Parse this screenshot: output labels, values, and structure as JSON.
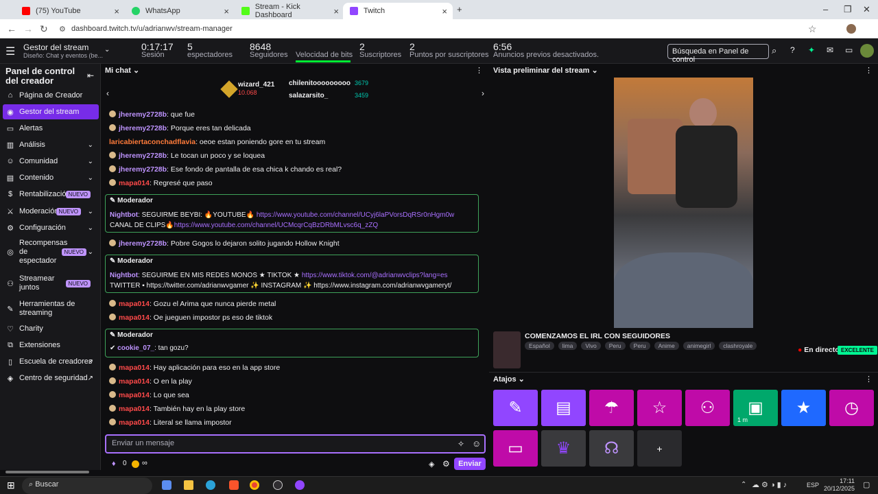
{
  "browser": {
    "tabs": [
      {
        "label": "(75) YouTube",
        "color": "#ff0000"
      },
      {
        "label": "WhatsApp",
        "color": "#25d366"
      },
      {
        "label": "Stream - Kick Dashboard",
        "color": "#53fc18"
      },
      {
        "label": "Twitch",
        "color": "#9146ff"
      }
    ],
    "url": "dashboard.twitch.tv/u/adrianwv/stream-manager"
  },
  "header": {
    "title": "Gestor del stream",
    "subtitle": "Diseño: Chat y eventos (be...",
    "search_placeholder": "Búsqueda en Panel de control"
  },
  "stats": [
    {
      "value": "0:17:17",
      "label": "Sesión"
    },
    {
      "value": "5",
      "label": "espectadores"
    },
    {
      "value": "8648",
      "label": "Seguidores"
    },
    {
      "value": "",
      "label": "Velocidad de bits"
    },
    {
      "value": "2",
      "label": "Suscriptores"
    },
    {
      "value": "2",
      "label": "Puntos por suscriptores"
    },
    {
      "value": "6:56",
      "label": "Anuncios previos desactivados."
    }
  ],
  "sidebar": {
    "title": "Panel de control del creador",
    "items": [
      "Página de Creador",
      "Gestor del stream",
      "Alertas",
      "Análisis",
      "Comunidad",
      "Contenido",
      "Rentabilización",
      "Moderación",
      "Configuración",
      "Recompensas de espectador",
      "Streamear juntos",
      "Herramientas de streaming",
      "Charity",
      "Extensiones",
      "Escuela de creadores",
      "Centro de seguridad"
    ],
    "new_badge": "NUEVO"
  },
  "chat": {
    "title": "Mi chat",
    "leaders": {
      "first": "wizard_421",
      "first_pts": "10.068",
      "second": "chilenitooooooooo",
      "second_pts": "3679",
      "third": "salazarsito_",
      "third_pts": "3459"
    },
    "messages": [
      {
        "user": "jheremy2728b",
        "text": ": que fue",
        "c": "u-p"
      },
      {
        "user": "jheremy2728b",
        "text": ": Porque eres tan delicada",
        "c": "u-p"
      },
      {
        "user": "laricabiertaconchadflavia",
        "text": ": oeoe estan poniendo gore en tu stream",
        "c": "u-o"
      },
      {
        "user": "jheremy2728b",
        "text": ": Le tocan un poco y se loquea",
        "c": "u-p"
      },
      {
        "user": "jheremy2728b",
        "text": ": Ese fondo de pantalla de esa chica k chando es real?",
        "c": "u-p"
      },
      {
        "user": "mapa014",
        "text": ": Regresé que paso",
        "c": "u-r"
      }
    ],
    "mod_label": "Moderador",
    "nightbot1_a": "Nightbot",
    "nightbot1_b": ": SEGUIRME BEYBI: 🔥YOUTUBE🔥 ",
    "nightbot1_link": "https://www.youtube.com/channel/UCyj6laPVorsDqRSr0nHgm0w",
    "nightbot1_c": "CANAL DE CLIPS🔥",
    "nightbot1_link2": "https://www.youtube.com/channel/UCMcqrCqBzDRbMLvsc6q_zZQ",
    "mid_user": "jheremy2728b",
    "mid_text": ": Pobre Gogos lo dejaron solito jugando Hollow Knight",
    "nightbot2_b": ": SEGUIRME EN MIS REDES MONOS ★ TIKTOK ★ ",
    "nightbot2_link": "https://www.tiktok.com/@adrianwvclips?lang=es",
    "nightbot2_c": "TWITTER ▪ https://twitter.com/adrianwvgamer ✨ INSTAGRAM ✨ https://www.instagram.com/adrianwvgameryt/",
    "m2": [
      {
        "user": "mapa014",
        "text": ": Gozu el Arima que nunca pierde metal"
      },
      {
        "user": "mapa014",
        "text": ": Oe jueguen impostor ps eso de tiktok"
      }
    ],
    "cookie_user": "cookie_07_",
    "cookie_text": ": tan gozu?",
    "m3": [
      {
        "user": "mapa014",
        "text": ": Hay aplicación para eso en la app store"
      },
      {
        "user": "mapa014",
        "text": ": O en la play"
      },
      {
        "user": "mapa014",
        "text": ": Lo que sea"
      },
      {
        "user": "mapa014",
        "text": ": También hay en la play store"
      },
      {
        "user": "mapa014",
        "text": ": Literal se llama impostor"
      }
    ],
    "input_placeholder": "Enviar un mensaje",
    "points": "0",
    "infinity": "∞",
    "send": "Enviar"
  },
  "preview": {
    "title": "Vista preliminar del stream",
    "stream_title": "COMENZAMOS EL IRL CON SEGUIDORES",
    "tags": [
      "Español",
      "lima",
      "Vivo",
      "Peru",
      "Peru",
      "Anime",
      "animegirl",
      "clashroyale"
    ],
    "live": "En directo",
    "quality": "EXCELENTE"
  },
  "shortcuts": {
    "title": "Atajos",
    "timer": "1 m"
  },
  "taskbar": {
    "search": "Buscar",
    "lang": "ESP",
    "time": "17:11",
    "date": "20/12/2025"
  }
}
